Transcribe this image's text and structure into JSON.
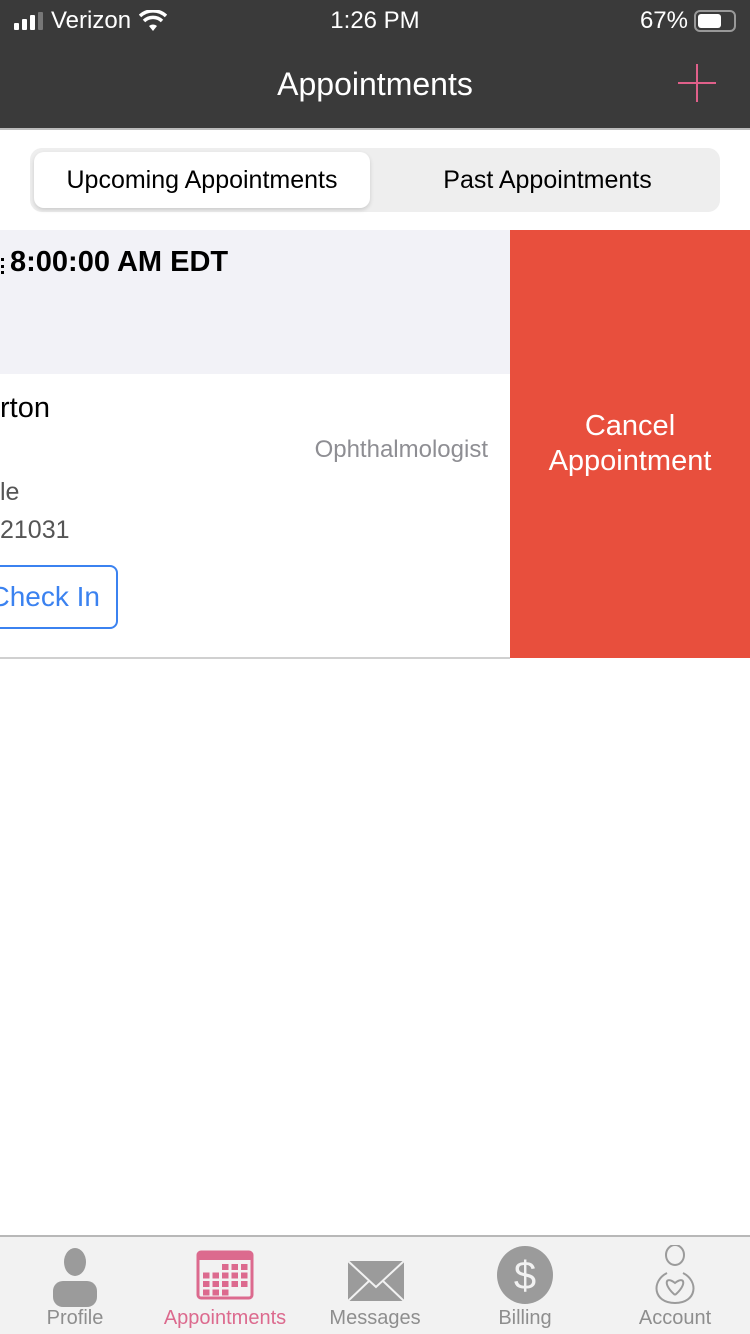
{
  "status_bar": {
    "carrier": "Verizon",
    "time": "1:26 PM",
    "battery": "67%",
    "battery_level": 0.67
  },
  "nav": {
    "title": "Appointments",
    "add_icon": "plus-icon"
  },
  "segments": {
    "upcoming": "Upcoming Appointments",
    "past": "Past Appointments",
    "selected": "upcoming"
  },
  "appointment": {
    "date": "8:00:00 AM EDT",
    "name": "rton",
    "specialty": "Ophthalmologist",
    "address_line1": "le",
    "address_line2": "21031",
    "checkin_label": "Check In"
  },
  "swipe_action": {
    "label": "Cancel Appointment",
    "color": "#e84f3d"
  },
  "tabbar": {
    "active_color": "#dc6a8e",
    "items": [
      {
        "label": "Profile",
        "icon": "person-icon"
      },
      {
        "label": "Appointments",
        "icon": "calendar-icon"
      },
      {
        "label": "Messages",
        "icon": "envelope-icon"
      },
      {
        "label": "Billing",
        "icon": "dollar-icon"
      },
      {
        "label": "Account",
        "icon": "account-heart-icon"
      }
    ]
  }
}
